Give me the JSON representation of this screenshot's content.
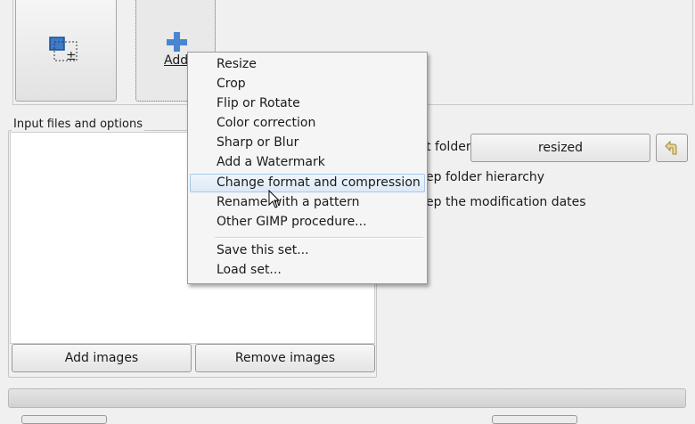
{
  "toolbar": {
    "add_button_label": "Add"
  },
  "input_group": {
    "title": "Input files and options",
    "add_images_label": "Add images",
    "remove_images_label": "Remove images"
  },
  "output": {
    "output_folder_label_visible": "t folder",
    "folder_value": "resized",
    "keep_hierarchy_label_visible": "ep folder hierarchy",
    "keep_dates_label_visible": "ep the modification dates"
  },
  "context_menu": {
    "items": [
      "Resize",
      "Crop",
      "Flip or Rotate",
      "Color correction",
      "Sharp or Blur",
      "Add a Watermark",
      "Change format and compression",
      "Rename with a pattern",
      "Other GIMP procedure...",
      "Save this set...",
      "Load set..."
    ],
    "hovered_index": 6
  },
  "icons": {
    "layer_icon": "layer-resize-icon",
    "add_icon": "plus-icon",
    "back_icon": "arrow-back-icon",
    "cursor": "mouse-pointer-icon"
  },
  "colors": {
    "accent": "#3d7ac7",
    "menu_hover": "#dce9f7"
  }
}
